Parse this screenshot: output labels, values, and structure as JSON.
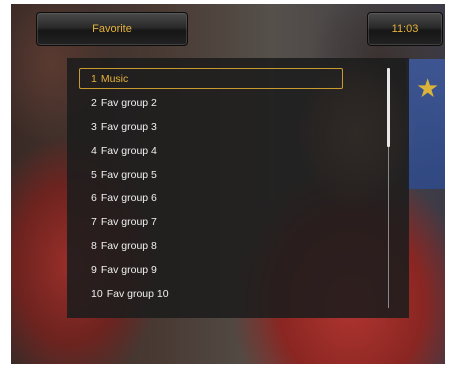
{
  "header": {
    "title": "Favorite",
    "clock": "11:03"
  },
  "favorite_list": {
    "selected_index": 0,
    "items": [
      {
        "number": "1",
        "label": "Music"
      },
      {
        "number": "2",
        "label": "Fav group 2"
      },
      {
        "number": "3",
        "label": "Fav group 3"
      },
      {
        "number": "4",
        "label": "Fav group 4"
      },
      {
        "number": "5",
        "label": "Fav group 5"
      },
      {
        "number": "6",
        "label": "Fav group 6"
      },
      {
        "number": "7",
        "label": "Fav group 7"
      },
      {
        "number": "8",
        "label": "Fav group 8"
      },
      {
        "number": "9",
        "label": "Fav group 9"
      },
      {
        "number": "10",
        "label": "Fav group 10"
      }
    ]
  },
  "scrollbar": {
    "position_fraction": 0.0,
    "visible_fraction": 0.33
  },
  "colors": {
    "accent": "#e6b23a",
    "panel": "#1c1c1c",
    "text": "#f0f0f0"
  }
}
